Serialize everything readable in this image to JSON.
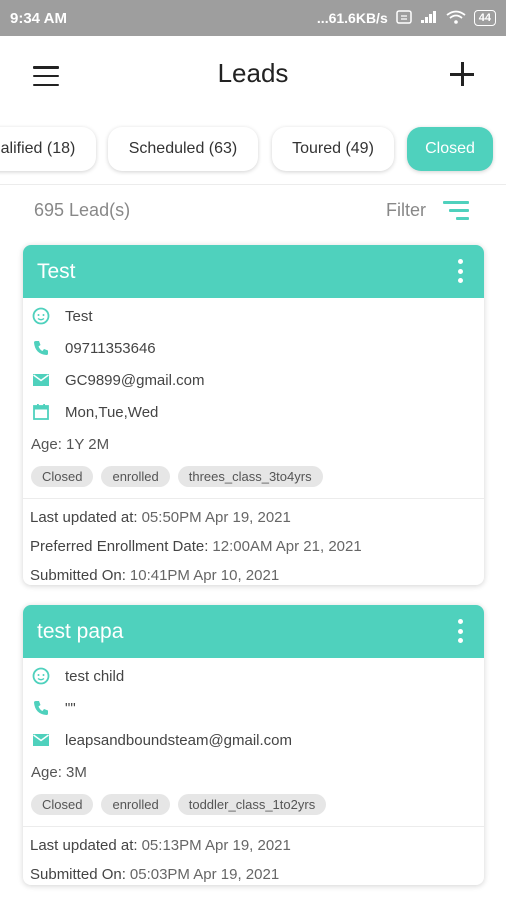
{
  "status_bar": {
    "time": "9:34 AM",
    "network_speed": "...61.6KB/s",
    "battery": "44",
    "icons": [
      "sim-icon",
      "signal-icon",
      "wifi-icon",
      "battery-icon"
    ]
  },
  "header": {
    "title": "Leads",
    "menu_icon": "hamburger-menu-icon",
    "add_icon": "plus-icon"
  },
  "tabs": [
    {
      "label": "alified (18)",
      "active": false
    },
    {
      "label": "Scheduled (63)",
      "active": false
    },
    {
      "label": "Toured (49)",
      "active": false
    },
    {
      "label": "Closed",
      "active": true
    }
  ],
  "summary": {
    "lead_count": "695 Lead(s)",
    "filter_label": "Filter"
  },
  "colors": {
    "accent": "#4fd1bd",
    "status_bar": "#9e9e9e"
  },
  "leads": [
    {
      "name": "Test",
      "child": "Test",
      "phone": "09711353646",
      "email": "GC9899@gmail.com",
      "days": "Mon,Tue,Wed",
      "age": "Age: 1Y 2M",
      "tags": [
        "Closed",
        "enrolled",
        "threes_class_3to4yrs"
      ],
      "last_updated_label": "Last updated at:",
      "last_updated": "05:50PM Apr 19, 2021",
      "preferred_label": "Preferred Enrollment Date:",
      "preferred": "12:00AM Apr 21, 2021",
      "submitted_label": "Submitted On:",
      "submitted": "10:41PM Apr 10, 2021"
    },
    {
      "name": "test papa",
      "child": "test child",
      "phone": "\"\"",
      "email": "leapsandboundsteam@gmail.com",
      "age": "Age: 3M",
      "tags": [
        "Closed",
        "enrolled",
        "toddler_class_1to2yrs"
      ],
      "last_updated_label": "Last updated at:",
      "last_updated": "05:13PM Apr 19, 2021",
      "submitted_label": "Submitted On:",
      "submitted": "05:03PM Apr 19, 2021"
    }
  ]
}
